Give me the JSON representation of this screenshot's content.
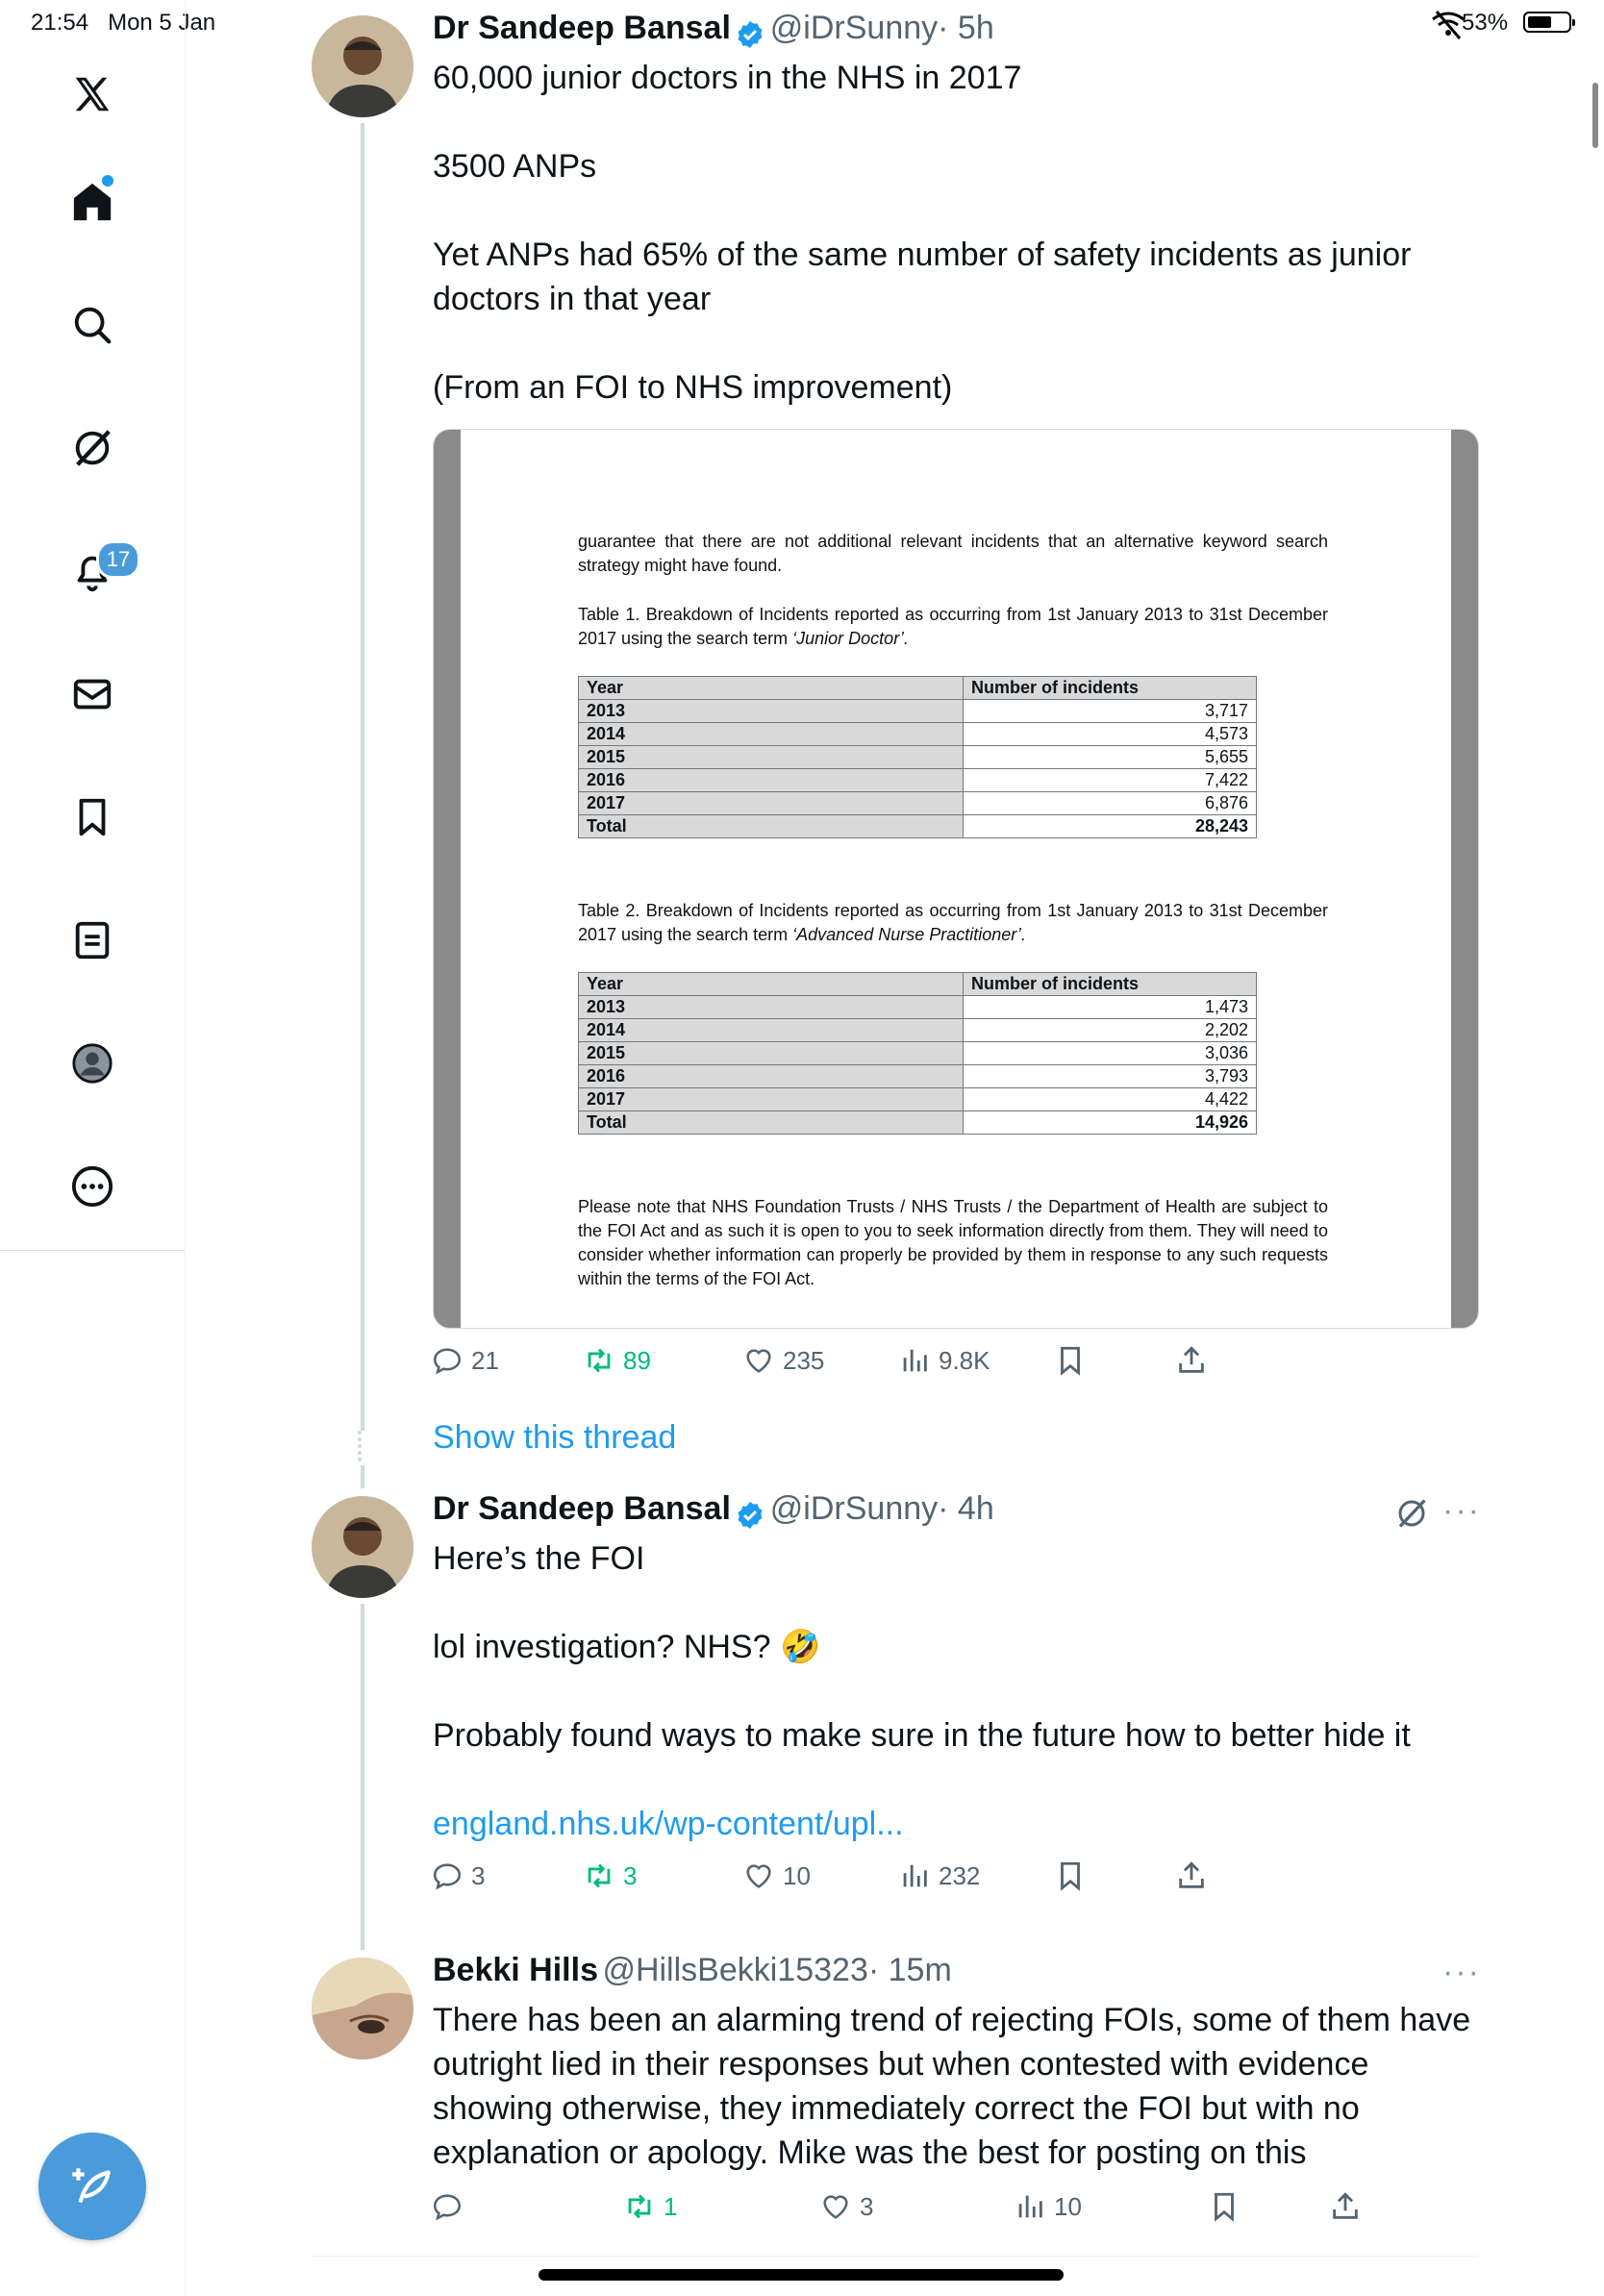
{
  "status_bar": {
    "time": "21:54",
    "date": "Mon 5 Jan",
    "battery": "53%"
  },
  "sidebar": {
    "items": [
      {
        "icon": "x-logo-icon"
      },
      {
        "icon": "home-icon"
      },
      {
        "icon": "search-icon"
      },
      {
        "icon": "grok-icon"
      },
      {
        "icon": "notifications-icon",
        "badge": "17"
      },
      {
        "icon": "messages-icon"
      },
      {
        "icon": "bookmarks-icon"
      },
      {
        "icon": "lists-icon"
      },
      {
        "icon": "profile-icon"
      },
      {
        "icon": "more-icon"
      }
    ],
    "compose": {
      "icon": "compose-icon"
    }
  },
  "tweet1": {
    "name": "Dr Sandeep Bansal",
    "handle": "@iDrSunny",
    "time": "· 5h",
    "lines": [
      "60,000 junior doctors in the NHS in 2017",
      "3500 ANPs",
      "Yet ANPs had 65% of the same number of safety incidents as junior",
      "doctors in that year",
      "(From an FOI to NHS improvement)"
    ],
    "document": {
      "intro": "guarantee that there are not additional relevant incidents that an alternative keyword search strategy might have found.",
      "table1_caption": "Table 1. Breakdown of Incidents reported as occurring from 1st January 2013 to 31st December 2017 using the search term ",
      "table1_term": "‘Junior Doctor’.",
      "table2_caption": "Table 2. Breakdown of Incidents reported as occurring from 1st January 2013 to 31st December 2017 using the search term ",
      "table2_term": "‘Advanced Nurse Practitioner’.",
      "col_year": "Year",
      "col_incidents": "Number of incidents",
      "table1_rows": [
        {
          "year": "2013",
          "value": "3,717"
        },
        {
          "year": "2014",
          "value": "4,573"
        },
        {
          "year": "2015",
          "value": "5,655"
        },
        {
          "year": "2016",
          "value": "7,422"
        },
        {
          "year": "2017",
          "value": "6,876"
        },
        {
          "year": "Total",
          "value": "28,243"
        }
      ],
      "table2_rows": [
        {
          "year": "2013",
          "value": "1,473"
        },
        {
          "year": "2014",
          "value": "2,202"
        },
        {
          "year": "2015",
          "value": "3,036"
        },
        {
          "year": "2016",
          "value": "3,793"
        },
        {
          "year": "2017",
          "value": "4,422"
        },
        {
          "year": "Total",
          "value": "14,926"
        }
      ],
      "note": "Please note that NHS Foundation Trusts / NHS Trusts / the Department of Health are subject to the FOI Act and as such it is open to you to seek information directly from them. They will need to consider whether information can properly be provided by them in response to any such requests within the terms of the FOI Act."
    },
    "actions": {
      "replies": "21",
      "reposts": "89",
      "likes": "235",
      "views": "9.8K"
    },
    "show_thread": "Show this thread"
  },
  "tweet2": {
    "name": "Dr Sandeep Bansal",
    "handle": "@iDrSunny",
    "time": "· 4h",
    "lines": [
      "Here’s the FOI",
      "lol investigation? NHS? 🤣",
      "Probably found ways to make sure in the future how to better hide it"
    ],
    "link": "england.nhs.uk/wp-content/upl...",
    "actions": {
      "replies": "3",
      "reposts": "3",
      "likes": "10",
      "views": "232"
    }
  },
  "tweet3": {
    "name": "Bekki Hills",
    "handle": "@HillsBekki15323",
    "time": "· 15m",
    "lines": [
      "There has been an alarming trend of rejecting FOIs, some of them have",
      "outright lied in their responses but when contested with evidence",
      "showing otherwise, they immediately correct the FOI but with no",
      "explanation or apology. Mike was the best for posting on this"
    ],
    "actions": {
      "replies": "",
      "reposts": "1",
      "likes": "3",
      "views": "10"
    }
  },
  "colors": {
    "accent": "#1d9bf0",
    "repost_green": "#00ba7c",
    "muted": "#536471"
  }
}
